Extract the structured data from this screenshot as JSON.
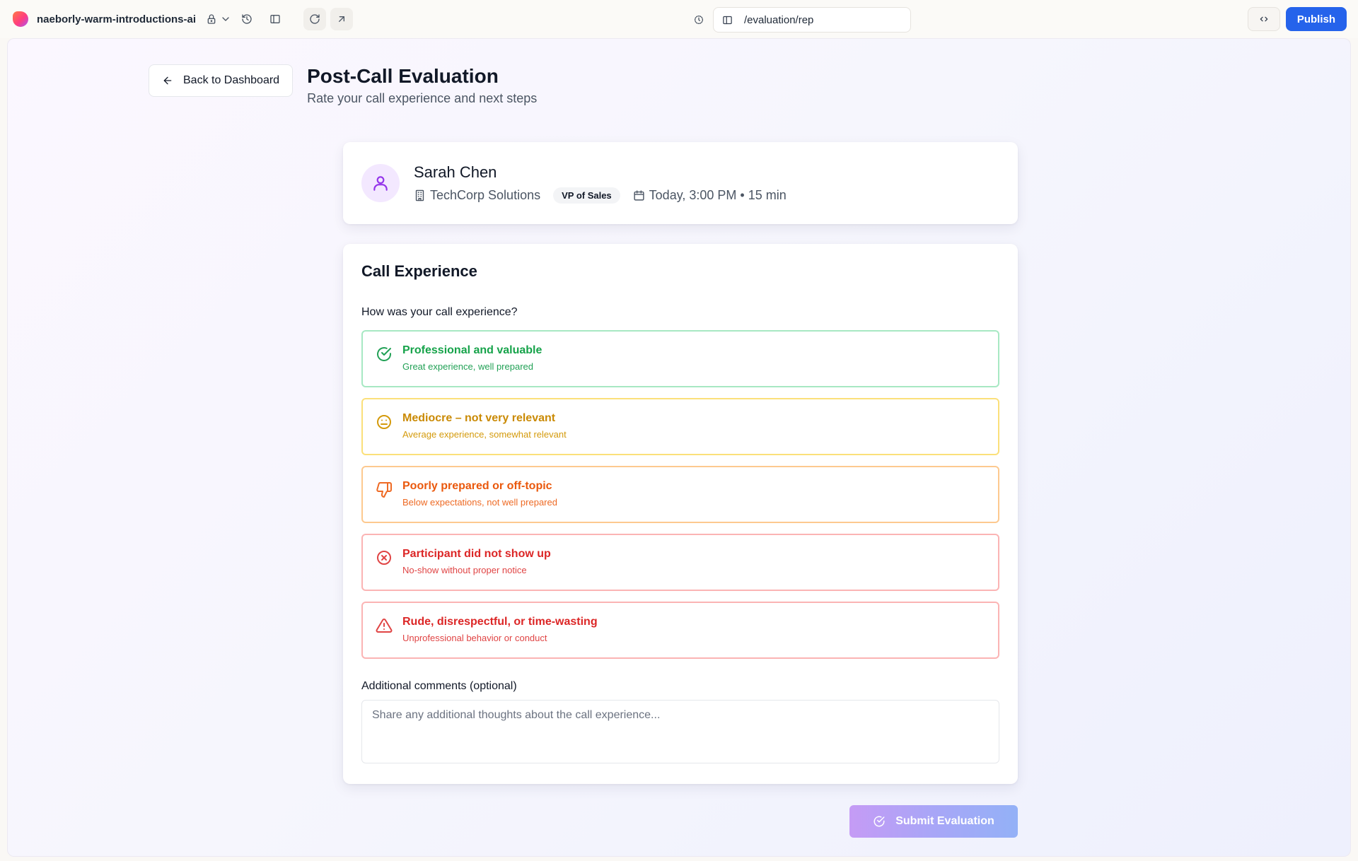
{
  "topbar": {
    "project_name": "naeborly-warm-introductions-ai",
    "url_path": "/evaluation/rep",
    "publish_label": "Publish"
  },
  "header": {
    "back_label": "Back to Dashboard",
    "title": "Post-Call Evaluation",
    "subtitle": "Rate your call experience and next steps"
  },
  "profile": {
    "name": "Sarah Chen",
    "company": "TechCorp Solutions",
    "role": "VP of Sales",
    "schedule": "Today, 3:00 PM • 15 min"
  },
  "experience": {
    "section_title": "Call Experience",
    "question": "How was your call experience?",
    "options": [
      {
        "label": "Professional and valuable",
        "desc": "Great experience, well prepared",
        "icon": "check-circle-icon",
        "color": "#16a34a"
      },
      {
        "label": "Mediocre – not very relevant",
        "desc": "Average experience, somewhat relevant",
        "icon": "meh-face-icon",
        "color": "#ca8a04"
      },
      {
        "label": "Poorly prepared or off-topic",
        "desc": "Below expectations, not well prepared",
        "icon": "thumbs-down-icon",
        "color": "#ea580c"
      },
      {
        "label": "Participant did not show up",
        "desc": "No-show without proper notice",
        "icon": "x-circle-icon",
        "color": "#dc2626"
      },
      {
        "label": "Rude, disrespectful, or time-wasting",
        "desc": "Unprofessional behavior or conduct",
        "icon": "warning-triangle-icon",
        "color": "#dc2626"
      }
    ],
    "comments_label": "Additional comments (optional)",
    "comments_placeholder": "Share any additional thoughts about the call experience...",
    "comments_value": ""
  },
  "submit": {
    "label": "Submit Evaluation"
  },
  "colors": {
    "accent": "#2563eb",
    "avatar_bg": "#f3e8ff",
    "avatar_icon": "#9333ea"
  }
}
